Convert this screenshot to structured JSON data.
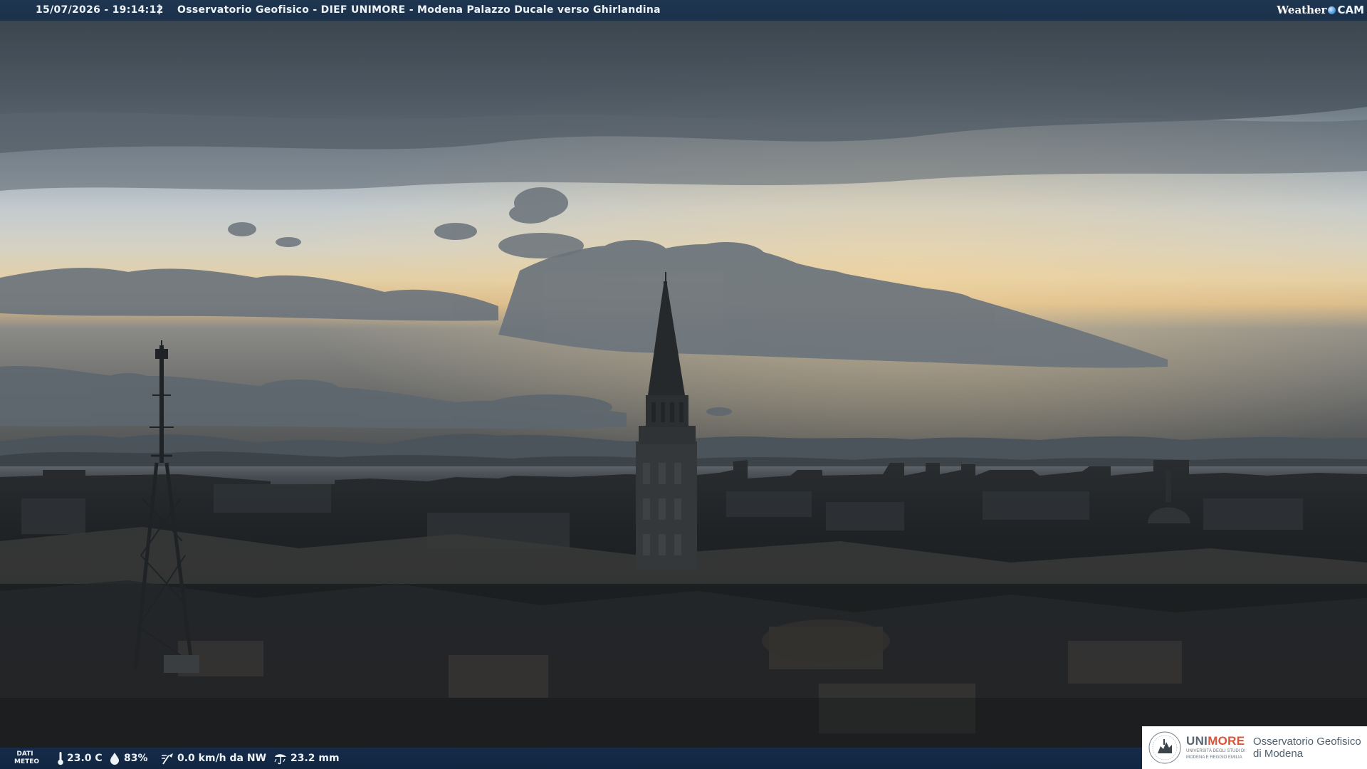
{
  "header": {
    "timestamp": "15/07/2026 - 19:14:12",
    "separator": "|",
    "title": "Osservatorio Geofisico - DIEF UNIMORE - Modena Palazzo Ducale verso Ghirlandina",
    "brand_left": "Weather",
    "brand_right": "CAM"
  },
  "weather": {
    "label_line1": "DATI",
    "label_line2": "METEO",
    "temperature": "23.0 C",
    "humidity": "83%",
    "wind": "0.0 km/h da NW",
    "rain": "23.2 mm",
    "icons": [
      "thermometer-icon",
      "humidity-drop-icon",
      "wind-vane-icon",
      "rain-gauge-icon"
    ]
  },
  "logo": {
    "uni_a": "UNI",
    "uni_b": "MORE",
    "uni_sub1": "UNIVERSITÀ DEGLI STUDI DI",
    "uni_sub2": "MODENA E REGGIO EMILIA",
    "obs_line1": "Osservatorio Geofisico",
    "obs_line2": "di Modena"
  },
  "colors": {
    "bar": "#1c3450",
    "unimore_orange": "#d8553a",
    "unimore_grey": "#5a6570"
  }
}
